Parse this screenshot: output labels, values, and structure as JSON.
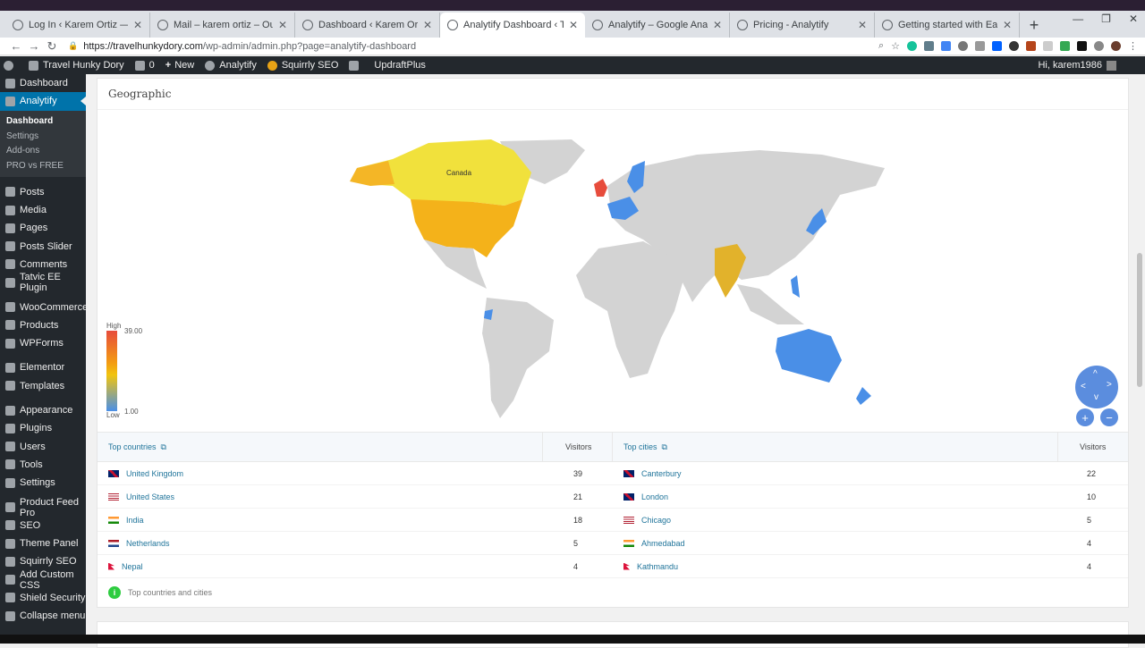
{
  "browser": {
    "tabs": [
      {
        "label": "Log In ‹ Karem Ortiz — WordPress",
        "icon": "wordpress-icon",
        "active": false
      },
      {
        "label": "Mail – karem ortiz – Outlook",
        "icon": "outlook-icon",
        "active": false
      },
      {
        "label": "Dashboard ‹ Karem Ortiz — Wo…",
        "icon": "wordpress-icon",
        "active": false
      },
      {
        "label": "Analytify Dashboard ‹ Travel Hunky",
        "icon": "analytify-icon",
        "active": true
      },
      {
        "label": "Analytify – Google Analytics Das",
        "icon": "wordpress-icon",
        "active": false
      },
      {
        "label": "Pricing - Analytify",
        "icon": "analytify-icon",
        "active": false
      },
      {
        "label": "Getting started with Easy Digital",
        "icon": "globe-icon",
        "active": false
      }
    ],
    "url_host": "https://travelhunkydory.com",
    "url_path": "/wp-admin/admin.php?page=analytify-dashboard"
  },
  "adminbar": {
    "site": "Travel Hunky Dory",
    "comments": "0",
    "new": "New",
    "analytify": "Analytify",
    "squirrly": "Squirrly SEO",
    "updraft": "UpdraftPlus",
    "howdy": "Hi, karem1986"
  },
  "sidebar": {
    "top": [
      {
        "label": "Dashboard",
        "icon": "dashboard-icon"
      },
      {
        "label": "Analytify",
        "icon": "analytify-icon",
        "active": true
      }
    ],
    "submenu": [
      {
        "label": "Dashboard",
        "current": true
      },
      {
        "label": "Settings"
      },
      {
        "label": "Add-ons"
      },
      {
        "label": "PRO vs FREE"
      }
    ],
    "group1": [
      {
        "label": "Posts",
        "icon": "pin-icon"
      },
      {
        "label": "Media",
        "icon": "media-icon"
      },
      {
        "label": "Pages",
        "icon": "pages-icon"
      },
      {
        "label": "Posts Slider",
        "icon": "slider-icon"
      },
      {
        "label": "Comments",
        "icon": "comment-icon"
      },
      {
        "label": "Tatvic EE Plugin",
        "icon": "plugin-icon"
      }
    ],
    "group2": [
      {
        "label": "WooCommerce",
        "icon": "woo-icon"
      },
      {
        "label": "Products",
        "icon": "products-icon"
      },
      {
        "label": "WPForms",
        "icon": "forms-icon"
      }
    ],
    "group3": [
      {
        "label": "Elementor",
        "icon": "elementor-icon"
      },
      {
        "label": "Templates",
        "icon": "templates-icon"
      }
    ],
    "group4": [
      {
        "label": "Appearance",
        "icon": "appearance-icon"
      },
      {
        "label": "Plugins",
        "icon": "plugins-icon"
      },
      {
        "label": "Users",
        "icon": "users-icon"
      },
      {
        "label": "Tools",
        "icon": "tools-icon"
      },
      {
        "label": "Settings",
        "icon": "settings-icon"
      }
    ],
    "group5": [
      {
        "label": "Product Feed Pro",
        "icon": "feed-icon"
      },
      {
        "label": "SEO",
        "icon": "seo-icon"
      },
      {
        "label": "Theme Panel",
        "icon": "theme-icon"
      },
      {
        "label": "Squirrly SEO",
        "icon": "squirrly-icon"
      },
      {
        "label": "Add Custom CSS",
        "icon": "css-icon"
      },
      {
        "label": "Shield Security",
        "icon": "shield-icon"
      },
      {
        "label": "Collapse menu",
        "icon": "collapse-icon"
      }
    ]
  },
  "geo": {
    "title": "Geographic",
    "map_label": "Canada",
    "legend": {
      "high": "High",
      "low": "Low",
      "max": "39.00",
      "min": "1.00"
    },
    "colors": {
      "high": "#e74c3c",
      "mid": "#f1c40f",
      "low": "#4a8fe7",
      "none": "#d3d3d3"
    }
  },
  "countries": {
    "header": "Top countries",
    "visitors_header": "Visitors",
    "rows": [
      {
        "name": "United Kingdom",
        "visitors": "39",
        "flag": "uk"
      },
      {
        "name": "United States",
        "visitors": "21",
        "flag": "us"
      },
      {
        "name": "India",
        "visitors": "18",
        "flag": "in"
      },
      {
        "name": "Netherlands",
        "visitors": "5",
        "flag": "nl"
      },
      {
        "name": "Nepal",
        "visitors": "4",
        "flag": "np"
      }
    ]
  },
  "cities": {
    "header": "Top cities",
    "visitors_header": "Visitors",
    "rows": [
      {
        "name": "Canterbury",
        "visitors": "22",
        "flag": "uk"
      },
      {
        "name": "London",
        "visitors": "10",
        "flag": "uk"
      },
      {
        "name": "Chicago",
        "visitors": "5",
        "flag": "us"
      },
      {
        "name": "Ahmedabad",
        "visitors": "4",
        "flag": "in"
      },
      {
        "name": "Kathmandu",
        "visitors": "4",
        "flag": "np"
      }
    ]
  },
  "footer_note": "Top countries and cities"
}
